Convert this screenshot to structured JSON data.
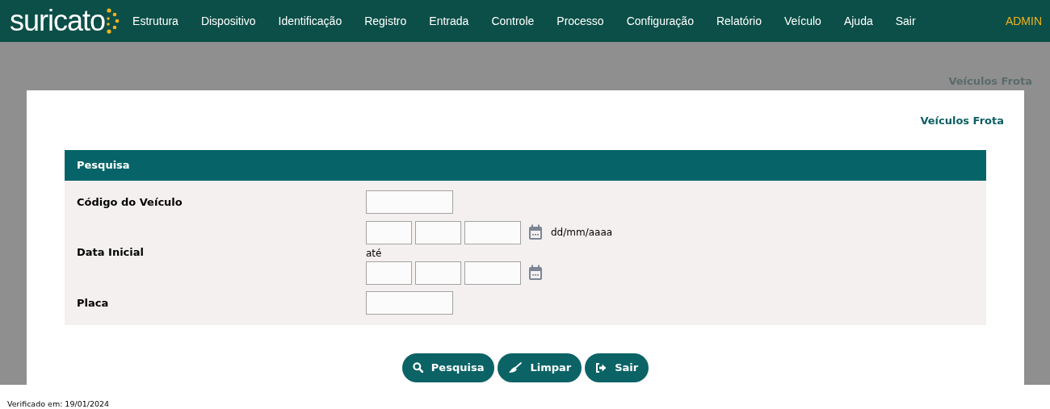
{
  "logo": {
    "text": "suricato"
  },
  "menu": [
    "Estrutura",
    "Dispositivo",
    "Identificação",
    "Registro",
    "Entrada",
    "Controle",
    "Processo",
    "Configuração",
    "Relatório",
    "Veículo",
    "Ajuda",
    "Sair"
  ],
  "user": "ADMIN",
  "breadcrumb": "Veículos Frota",
  "page_title": "Veículos Frota",
  "form": {
    "title": "Pesquisa",
    "fields": [
      {
        "kind": "text",
        "label": "Código do Veículo"
      },
      {
        "kind": "date_range",
        "label": "Data Inicial",
        "format_hint": "dd/mm/aaaa",
        "separator": "até"
      },
      {
        "kind": "text",
        "label": "Placa"
      }
    ]
  },
  "buttons": [
    {
      "kind": "search",
      "label": "Pesquisa"
    },
    {
      "kind": "clear",
      "label": "Limpar"
    },
    {
      "kind": "exit",
      "label": "Sair"
    }
  ],
  "footer": "Verificado em: 19/01/2024"
}
